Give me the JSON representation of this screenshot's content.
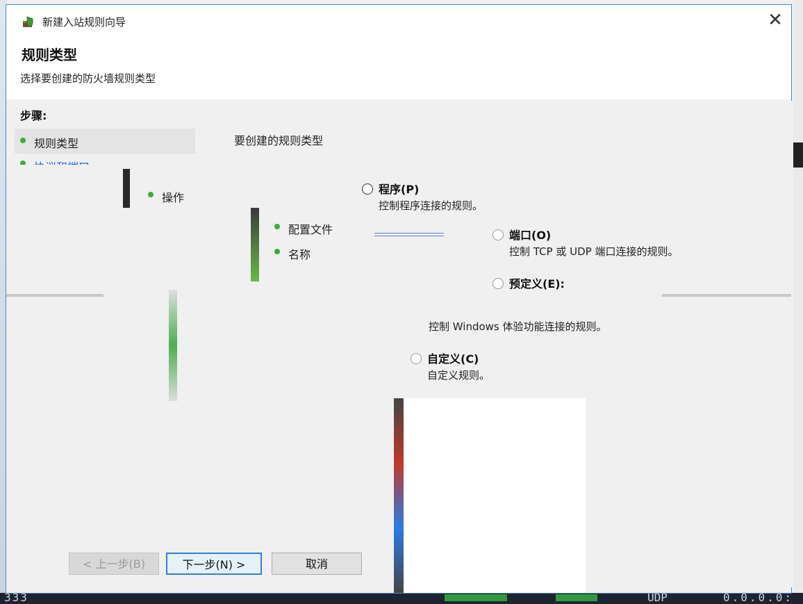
{
  "window": {
    "title": "新建入站规则向导",
    "close_glyph": "✕"
  },
  "header": {
    "title": "规则类型",
    "subtitle": "选择要创建的防火墙规则类型"
  },
  "steps": {
    "heading": "步骤:",
    "items": [
      {
        "label": "规则类型"
      },
      {
        "label": "协议和端口"
      },
      {
        "label": "操作"
      },
      {
        "label": "配置文件"
      },
      {
        "label": "名称"
      }
    ]
  },
  "main": {
    "question": "要创建的规则类型",
    "options": [
      {
        "label": "程序(P)",
        "desc": "控制程序连接的规则。"
      },
      {
        "label": "端口(O)",
        "desc": "控制 TCP 或 UDP 端口连接的规则。"
      },
      {
        "label": "预定义(E):",
        "desc": "控制 Windows 体验功能连接的规则。"
      },
      {
        "label": "自定义(C)",
        "desc": "自定义规则。"
      }
    ]
  },
  "footer": {
    "back": "< 上一步(B)",
    "next": "下一步(N) >",
    "cancel": "取消"
  },
  "taskbar": {
    "left_text": "333",
    "mid_text": "UDP",
    "right_text": "0.0.0.0:"
  },
  "colors": {
    "accent": "#2f7fd6",
    "step_dot": "#3eaa3e",
    "link": "#1a66cc"
  }
}
